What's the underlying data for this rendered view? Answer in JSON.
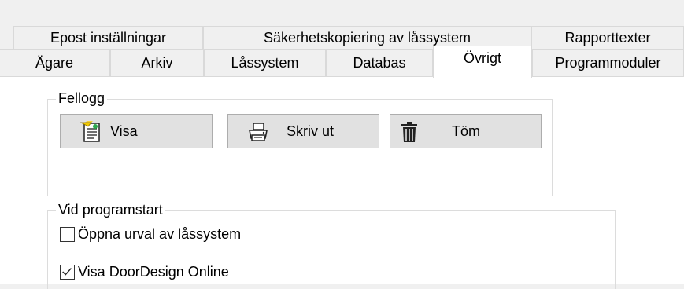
{
  "tabs_back": [
    {
      "label": "Epost inställningar"
    },
    {
      "label": "Säkerhetskopiering av låssystem"
    },
    {
      "label": "Rapporttexter"
    }
  ],
  "tabs_front": [
    {
      "label": "Ägare"
    },
    {
      "label": "Arkiv"
    },
    {
      "label": "Låssystem"
    },
    {
      "label": "Databas"
    },
    {
      "label": "Övrigt",
      "active": true
    },
    {
      "label": "Programmoduler"
    }
  ],
  "fellogg": {
    "title": "Fellogg",
    "show_label": "Visa",
    "print_label": "Skriv ut",
    "clear_label": "Töm"
  },
  "startup": {
    "title": "Vid programstart",
    "open_selection": {
      "label": "Öppna urval av låssystem",
      "checked": false
    },
    "show_doordesign": {
      "label": "Visa DoorDesign Online",
      "checked": true
    }
  },
  "colors": {
    "panel_bg": "#ffffff",
    "window_bg": "#f0f0f0",
    "border": "#d9d9d9",
    "button_bg": "#e1e1e1"
  }
}
